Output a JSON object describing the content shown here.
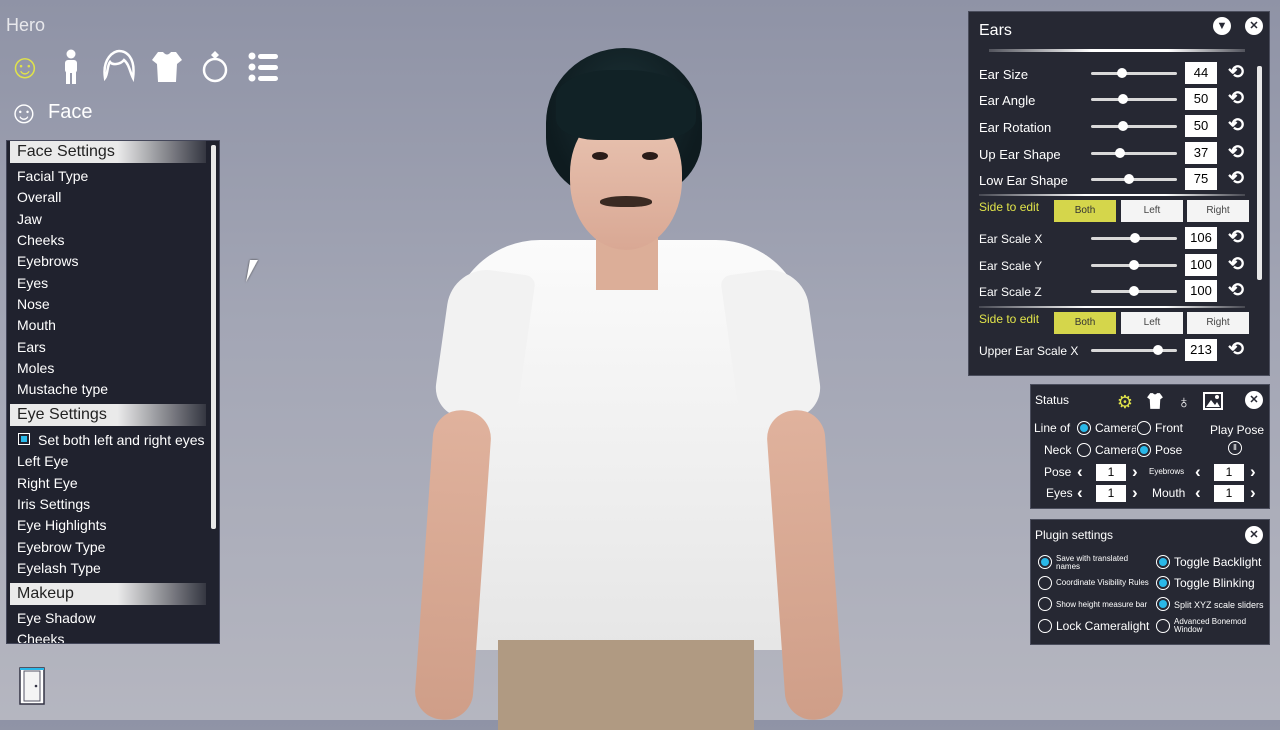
{
  "window": {
    "title": "Hero"
  },
  "category_icons": [
    "face-icon",
    "body-icon",
    "hair-icon",
    "clothes-icon",
    "accessory-icon",
    "list-icon"
  ],
  "face_header": {
    "label": "Face"
  },
  "face_panel": {
    "sections": [
      {
        "title": "Face Settings",
        "items": [
          "Facial Type",
          "Overall",
          "Jaw",
          "Cheeks",
          "Eyebrows",
          "Eyes",
          "Nose",
          "Mouth",
          "Ears",
          "Moles",
          "Mustache type"
        ]
      },
      {
        "title": "Eye Settings",
        "checkbox": "Set both left and right eyes",
        "items": [
          "Left Eye",
          "Right Eye",
          "Iris Settings",
          "Eye Highlights",
          "Eyebrow Type",
          "Eyelash Type"
        ]
      },
      {
        "title": "Makeup",
        "items": [
          "Eye Shadow",
          "Cheeks"
        ]
      }
    ]
  },
  "ears_panel": {
    "title": "Ears",
    "sliders": [
      {
        "label": "Ear Size",
        "value": 44
      },
      {
        "label": "Ear Angle",
        "value": 50
      },
      {
        "label": "Ear Rotation",
        "value": 50
      },
      {
        "label": "Up Ear Shape",
        "value": 37
      },
      {
        "label": "Low Ear Shape",
        "value": 75
      }
    ],
    "side_label": "Side to edit",
    "side_options": [
      "Both",
      "Left",
      "Right"
    ],
    "side_selected": "Both",
    "scale_sliders": [
      {
        "label": "Ear Scale X",
        "value": 106
      },
      {
        "label": "Ear Scale Y",
        "value": 100
      },
      {
        "label": "Ear Scale Z",
        "value": 100
      }
    ],
    "side_label_2": "Side to edit",
    "upper_slider": {
      "label": "Upper Ear Scale X",
      "value": 213
    }
  },
  "status_panel": {
    "title": "Status",
    "line_of_label": "Line of",
    "neck_label": "Neck",
    "camera_label": "Camera",
    "front_label": "Front",
    "pose_label": "Pose",
    "play_pose_label": "Play Pose",
    "pause_icon": "Ⅱ",
    "pose_value": "1",
    "eyebrows_label": "Eyebrows",
    "eyebrows_value": "1",
    "eyes_label": "Eyes",
    "eyes_value": "1",
    "mouth_label": "Mouth",
    "mouth_value": "1"
  },
  "plugin_panel": {
    "title": "Plugin settings",
    "options": [
      {
        "label": "Save with translated names",
        "checked": true,
        "small": true
      },
      {
        "label": "Toggle Backlight",
        "checked": true,
        "small": false
      },
      {
        "label": "Coordinate Visibility Rules",
        "checked": false,
        "small": true
      },
      {
        "label": "Toggle Blinking",
        "checked": true,
        "small": false
      },
      {
        "label": "Show height measure bar",
        "checked": false,
        "small": true
      },
      {
        "label": "Split XYZ scale sliders",
        "checked": true,
        "small": true
      },
      {
        "label": "Lock Cameralight",
        "checked": false,
        "small": false
      },
      {
        "label": "Advanced Bonemod Window",
        "checked": false,
        "small": true
      }
    ]
  },
  "colors": {
    "accent_yellow": "#d5d64b",
    "radio_blue": "#29b8e8",
    "panel_bg": "#262833"
  }
}
